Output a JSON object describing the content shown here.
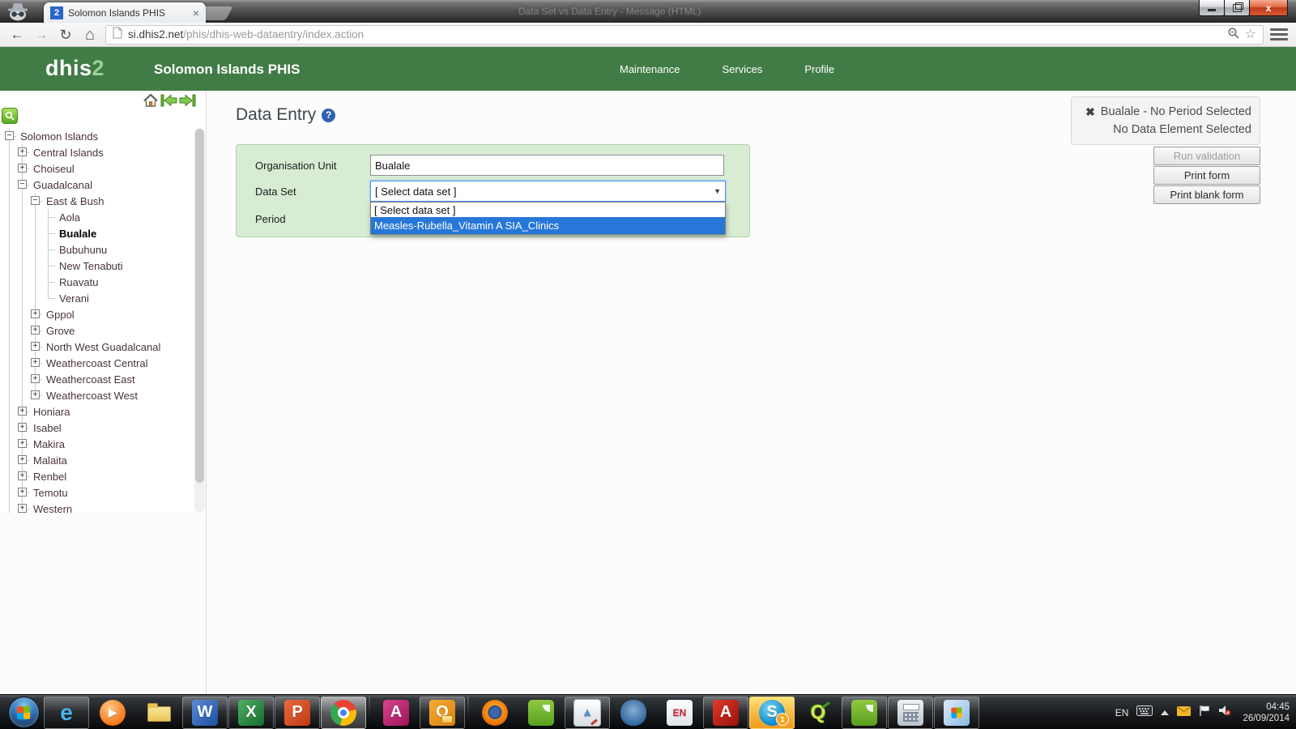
{
  "browser": {
    "tab": {
      "favicon_text": "2",
      "title": "Solomon Islands PHIS",
      "close_glyph": "×"
    },
    "background_window_title": "Data Set vs Data Entry - Message (HTML)",
    "url_domain": "si.dhis2.net",
    "url_path": "/phis/dhis-web-dataentry/index.action",
    "star_glyph": "☆",
    "back_glyph": "←",
    "forward_glyph": "→",
    "reload_glyph": "↻",
    "home_glyph": "⌂"
  },
  "header": {
    "logo_dhis": "dhis",
    "logo_2": "2",
    "app_title": "Solomon Islands PHIS",
    "menu": [
      {
        "label": "Maintenance"
      },
      {
        "label": "Services"
      },
      {
        "label": "Profile"
      }
    ]
  },
  "sidebar": {
    "tree": [
      {
        "label": "Solomon Islands",
        "level": 0,
        "toggle": "minus"
      },
      {
        "label": "Central Islands",
        "level": 1,
        "toggle": "plus"
      },
      {
        "label": "Choiseul",
        "level": 1,
        "toggle": "plus"
      },
      {
        "label": "Guadalcanal",
        "level": 1,
        "toggle": "minus"
      },
      {
        "label": "East & Bush",
        "level": 2,
        "toggle": "minus"
      },
      {
        "label": "Aola",
        "level": 3,
        "toggle": "none"
      },
      {
        "label": "Bualale",
        "level": 3,
        "toggle": "none",
        "bold": true
      },
      {
        "label": "Bubuhunu",
        "level": 3,
        "toggle": "none"
      },
      {
        "label": "New Tenabuti",
        "level": 3,
        "toggle": "none"
      },
      {
        "label": "Ruavatu",
        "level": 3,
        "toggle": "none"
      },
      {
        "label": "Verani",
        "level": 3,
        "toggle": "none",
        "last": true
      },
      {
        "label": "Gppol",
        "level": 2,
        "toggle": "plus"
      },
      {
        "label": "Grove",
        "level": 2,
        "toggle": "plus"
      },
      {
        "label": "North West Guadalcanal",
        "level": 2,
        "toggle": "plus"
      },
      {
        "label": "Weathercoast Central",
        "level": 2,
        "toggle": "plus"
      },
      {
        "label": "Weathercoast East",
        "level": 2,
        "toggle": "plus"
      },
      {
        "label": "Weathercoast West",
        "level": 2,
        "toggle": "plus",
        "last": true
      },
      {
        "label": "Honiara",
        "level": 1,
        "toggle": "plus"
      },
      {
        "label": "Isabel",
        "level": 1,
        "toggle": "plus"
      },
      {
        "label": "Makira",
        "level": 1,
        "toggle": "plus"
      },
      {
        "label": "Malaita",
        "level": 1,
        "toggle": "plus"
      },
      {
        "label": "Renbel",
        "level": 1,
        "toggle": "plus"
      },
      {
        "label": "Temotu",
        "level": 1,
        "toggle": "plus"
      },
      {
        "label": "Western",
        "level": 1,
        "toggle": "plus",
        "last": true
      }
    ]
  },
  "main": {
    "title": "Data Entry",
    "help_glyph": "?",
    "form": {
      "org_unit_label": "Organisation Unit",
      "org_unit_value": "Bualale",
      "dataset_label": "Data Set",
      "dataset_value": "[ Select data set ]",
      "period_label": "Period",
      "dropdown_options": [
        "[ Select data set ]",
        "Measles-Rubella_Vitamin A SIA_Clinics"
      ],
      "selected_option_index": 1
    }
  },
  "right_panel": {
    "clear_glyph": "✖",
    "status_line1": "Bualale - No Period Selected",
    "status_line2": "No Data Element Selected",
    "buttons": [
      {
        "label": "Run validation",
        "disabled": true
      },
      {
        "label": "Print form"
      },
      {
        "label": "Print blank form"
      }
    ]
  },
  "taskbar": {
    "items": [
      {
        "name": "start-button"
      },
      {
        "name": "internet-explorer-taskbar",
        "glyph": "e",
        "fg": "#45b3ef",
        "fs": 28,
        "active": true
      },
      {
        "name": "windows-media-player-taskbar",
        "glyph": "▶",
        "fg": "#ffffff",
        "fs": 13,
        "circle": true,
        "bg": "radial-gradient(circle at 40% 32%,#ffc98a,#f07514 72%)"
      },
      {
        "name": "windows-explorer-taskbar"
      },
      {
        "name": "ms-word-taskbar",
        "glyph": "W",
        "fg": "#ffffff",
        "bg": "linear-gradient(135deg,#5a8bd8,#1d4e9e)",
        "active": true
      },
      {
        "name": "ms-excel-taskbar",
        "glyph": "X",
        "fg": "#ffffff",
        "bg": "linear-gradient(135deg,#4fae63,#176b2f)",
        "active": true
      },
      {
        "name": "ms-powerpoint-taskbar",
        "glyph": "P",
        "fg": "#ffffff",
        "bg": "linear-gradient(135deg,#ec6a3e,#bd3a14)",
        "active": true
      },
      {
        "name": "google-chrome-taskbar",
        "focus": true
      },
      {
        "separator": true
      },
      {
        "name": "ms-access-taskbar",
        "glyph": "A",
        "fg": "#ffffff",
        "bg": "linear-gradient(135deg,#d8468c,#9c1258)"
      },
      {
        "name": "ms-outlook-taskbar",
        "glyph": "O",
        "fg": "#ffffff",
        "bg": "linear-gradient(135deg,#f3ae33,#dd7f0e)",
        "active": true
      },
      {
        "separator": true
      },
      {
        "name": "firefox-taskbar"
      },
      {
        "name": "evernote-taskbar"
      },
      {
        "name": "paint-taskbar",
        "glyph": "▲",
        "fg": "#5b8fc9",
        "fs": 15,
        "bg": "linear-gradient(#ffffff,#d6dce2)",
        "active": true
      },
      {
        "name": "postgresql-taskbar",
        "bg": "radial-gradient(circle at 50% 40%,#86add2,#2f659b 75%)"
      },
      {
        "name": "endnote-taskbar",
        "glyph": "EN",
        "fg": "#cc2233",
        "fs": 12,
        "bg": "linear-gradient(#fdfdfd,#dfe4e8)"
      },
      {
        "name": "adobe-reader-taskbar",
        "glyph": "A",
        "fg": "#ffffff",
        "bg": "linear-gradient(135deg,#e03a2b,#97120a)",
        "active": true
      },
      {
        "name": "skype-taskbar",
        "glyph": "S",
        "fg": "#ffffff",
        "fs": 20,
        "circle": true,
        "bg": "radial-gradient(circle at 40% 32%,#7fd4f2,#0084c9 75%)",
        "attention": true,
        "badge": "1"
      },
      {
        "name": "qgis-taskbar",
        "glyph": "Q",
        "fg": "#dce24e",
        "fs": 24
      },
      {
        "name": "evernote-2-taskbar",
        "active": true
      },
      {
        "name": "calculator-taskbar",
        "bg": "linear-gradient(#eef2f6,#b9c3cc)",
        "active": true
      },
      {
        "name": "windows-app-taskbar",
        "bg": "linear-gradient(135deg,#dcecfa,#8cb8e6)",
        "active": true
      }
    ],
    "tray": {
      "lang": "EN",
      "time": "04:45",
      "date": "26/09/2014"
    }
  },
  "colors": {
    "header_green": "#417c46",
    "logo_accent_green": "#9ccf94",
    "form_panel_green": "#d7ecd3",
    "form_panel_border": "#b2d0aa",
    "option_highlight_blue": "#2777d8",
    "select_focus_blue": "#4d90fe",
    "tree_link": "#4a3338",
    "close_button_red": "#c13a1c",
    "skype_attention_orange": "#f6b33c"
  }
}
